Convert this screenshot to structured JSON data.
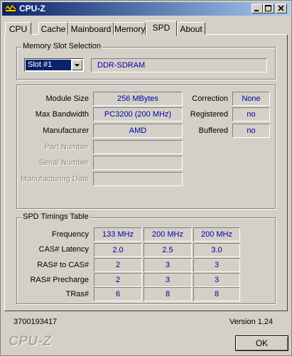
{
  "window": {
    "title": "CPU-Z"
  },
  "tabs": [
    {
      "label": "CPU"
    },
    {
      "label": "Cache"
    },
    {
      "label": "Mainboard"
    },
    {
      "label": "Memory"
    },
    {
      "label": "SPD"
    },
    {
      "label": "About"
    }
  ],
  "slot_selection": {
    "legend": "Memory Slot Selection",
    "selected_slot": "Slot #1",
    "memory_type": "DDR-SDRAM"
  },
  "module": {
    "module_size_label": "Module Size",
    "module_size": "256 MBytes",
    "max_bandwidth_label": "Max Bandwidth",
    "max_bandwidth": "PC3200 (200 MHz)",
    "manufacturer_label": "Manufacturer",
    "manufacturer": "AMD",
    "part_number_label": "Part Number",
    "serial_number_label": "Serial Number",
    "manufacturing_date_label": "Manufacturing Date",
    "correction_label": "Correction",
    "correction": "None",
    "registered_label": "Registered",
    "registered": "no",
    "buffered_label": "Buffered",
    "buffered": "no"
  },
  "timings": {
    "legend": "SPD Timings Table",
    "rows": [
      {
        "label": "Frequency",
        "values": [
          "133 MHz",
          "200 MHz",
          "200 MHz"
        ]
      },
      {
        "label": "CAS# Latency",
        "values": [
          "2.0",
          "2.5",
          "3.0"
        ]
      },
      {
        "label": "RAS# to CAS#",
        "values": [
          "2",
          "3",
          "3"
        ]
      },
      {
        "label": "RAS# Precharge",
        "values": [
          "2",
          "3",
          "3"
        ]
      },
      {
        "label": "TRas#",
        "values": [
          "6",
          "8",
          "8"
        ]
      }
    ]
  },
  "footer": {
    "serial": "3700193417",
    "version": "Version 1.24",
    "logo": "CPU-Z",
    "ok_label": "OK"
  },
  "colors": {
    "value_text": "#0000a8",
    "title_bar": "#0a246a",
    "face": "#d4d0c8"
  }
}
